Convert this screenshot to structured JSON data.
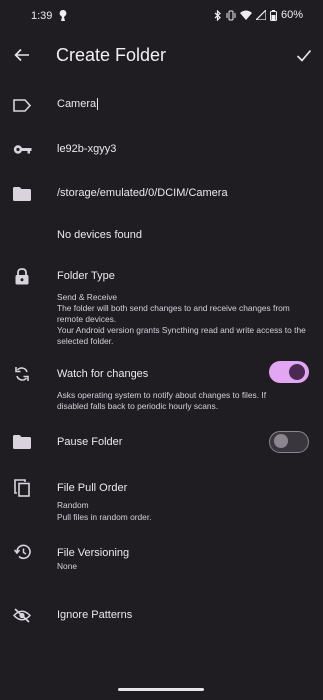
{
  "status_bar": {
    "time": "1:39",
    "battery": "60%"
  },
  "toolbar": {
    "title": "Create Folder"
  },
  "fields": {
    "label_value": "Camera",
    "id_value": "le92b-xgyy3",
    "path_value": "/storage/emulated/0/DCIM/Camera",
    "devices_text": "No devices found"
  },
  "folder_type": {
    "title": "Folder Type",
    "value": "Send & Receive",
    "description": "The folder will both send changes to and receive changes from remote devices.",
    "note": "Your Android version grants Syncthing read and write access to the selected folder."
  },
  "watch": {
    "title": "Watch for changes",
    "description": "Asks operating system to notify about changes to files. If disabled falls back to periodic hourly scans.",
    "enabled": true
  },
  "pause": {
    "title": "Pause Folder",
    "enabled": false
  },
  "pull_order": {
    "title": "File Pull Order",
    "value": "Random",
    "description": "Pull files in random order."
  },
  "versioning": {
    "title": "File Versioning",
    "value": "None"
  },
  "ignore": {
    "title": "Ignore Patterns"
  },
  "colors": {
    "accent": "#e3a6f2",
    "thumb_on": "#4a2a55",
    "track_off": "#3a363e"
  }
}
